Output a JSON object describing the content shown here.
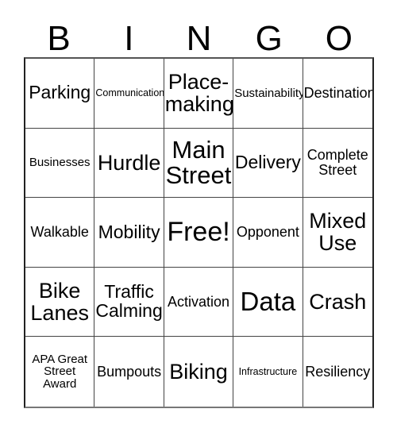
{
  "card": {
    "title_letters": [
      "B",
      "I",
      "N",
      "G",
      "O"
    ],
    "rows": [
      [
        {
          "label": "Parking",
          "size": "lg"
        },
        {
          "label": "Communication",
          "size": "xs"
        },
        {
          "label": "Place-making",
          "size": "xl"
        },
        {
          "label": "Sustainability",
          "size": "sm"
        },
        {
          "label": "Destination",
          "size": "md"
        }
      ],
      [
        {
          "label": "Businesses",
          "size": "sm"
        },
        {
          "label": "Hurdle",
          "size": "xl"
        },
        {
          "label": "Main Street",
          "size": "xxl"
        },
        {
          "label": "Delivery",
          "size": "lg"
        },
        {
          "label": "Complete Street",
          "size": "md"
        }
      ],
      [
        {
          "label": "Walkable",
          "size": "md"
        },
        {
          "label": "Mobility",
          "size": "lg"
        },
        {
          "label": "Free!",
          "size": "free"
        },
        {
          "label": "Opponent",
          "size": "md"
        },
        {
          "label": "Mixed Use",
          "size": "xl"
        }
      ],
      [
        {
          "label": "Bike Lanes",
          "size": "xl"
        },
        {
          "label": "Traffic Calming",
          "size": "lg"
        },
        {
          "label": "Activation",
          "size": "md"
        },
        {
          "label": "Data",
          "size": "data"
        },
        {
          "label": "Crash",
          "size": "xl"
        }
      ],
      [
        {
          "label": "APA Great Street Award",
          "size": "sm"
        },
        {
          "label": "Bumpouts",
          "size": "md"
        },
        {
          "label": "Biking",
          "size": "xl"
        },
        {
          "label": "Infrastructure",
          "size": "xs"
        },
        {
          "label": "Resiliency",
          "size": "md"
        }
      ]
    ],
    "colors": {
      "background": "#ffffff",
      "text": "#000000",
      "grid_line": "#444444",
      "grid_outer": "#222222"
    }
  }
}
